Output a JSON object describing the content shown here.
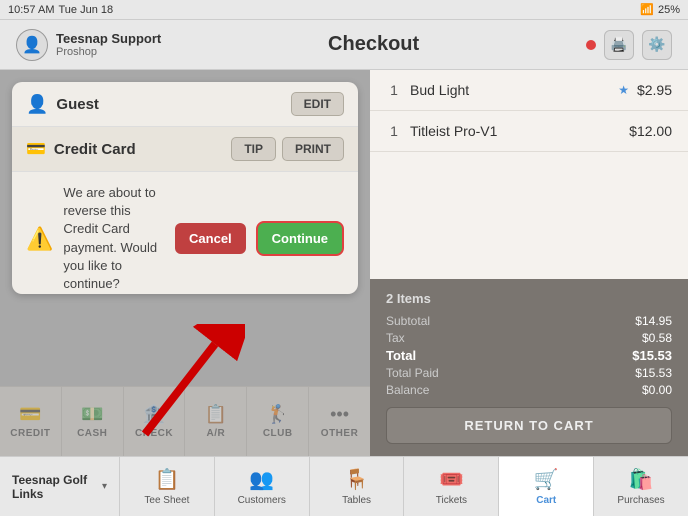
{
  "statusBar": {
    "time": "10:57 AM",
    "date": "Tue Jun 18",
    "battery": "25%"
  },
  "header": {
    "userName": "Teesnap Support",
    "userSub": "Proshop",
    "title": "Checkout",
    "avatar": "👤"
  },
  "dialog": {
    "guestLabel": "Guest",
    "editLabel": "EDIT",
    "ccLabel": "Credit Card",
    "tipLabel": "TIP",
    "printLabel": "PRINT",
    "warningText": "We are about to reverse this Credit Card payment. Would you like to continue?",
    "cancelLabel": "Cancel",
    "continueLabel": "Continue"
  },
  "paymentButtons": [
    {
      "icon": "💳",
      "label": "CREDIT"
    },
    {
      "icon": "💵",
      "label": "CASH"
    },
    {
      "icon": "🏦",
      "label": "CHECK"
    },
    {
      "icon": "📋",
      "label": "A/R"
    },
    {
      "icon": "🏌️",
      "label": "CLUB"
    },
    {
      "icon": "⋯",
      "label": "OTHER"
    }
  ],
  "cart": {
    "items": [
      {
        "qty": "1",
        "name": "Bud Light",
        "starred": true,
        "price": "$2.95"
      },
      {
        "qty": "1",
        "name": "Titleist Pro-V1",
        "starred": false,
        "price": "$12.00"
      }
    ],
    "summary": {
      "itemCount": "2 Items",
      "subtotalLabel": "Subtotal",
      "subtotalValue": "$14.95",
      "taxLabel": "Tax",
      "taxValue": "$0.58",
      "totalLabel": "Total",
      "totalValue": "$15.53",
      "totalPaidLabel": "Total Paid",
      "totalPaidValue": "$15.53",
      "balanceLabel": "Balance",
      "balanceValue": "$0.00"
    },
    "returnLabel": "RETURN TO CART"
  },
  "bottomNav": {
    "venue": "Teesnap Golf Links",
    "items": [
      {
        "icon": "📋",
        "label": "Tee Sheet",
        "active": false
      },
      {
        "icon": "👥",
        "label": "Customers",
        "active": false
      },
      {
        "icon": "🪑",
        "label": "Tables",
        "active": false
      },
      {
        "icon": "🎟️",
        "label": "Tickets",
        "active": false
      },
      {
        "icon": "🛒",
        "label": "Cart",
        "active": true
      },
      {
        "icon": "🛍️",
        "label": "Purchases",
        "active": false
      }
    ]
  }
}
